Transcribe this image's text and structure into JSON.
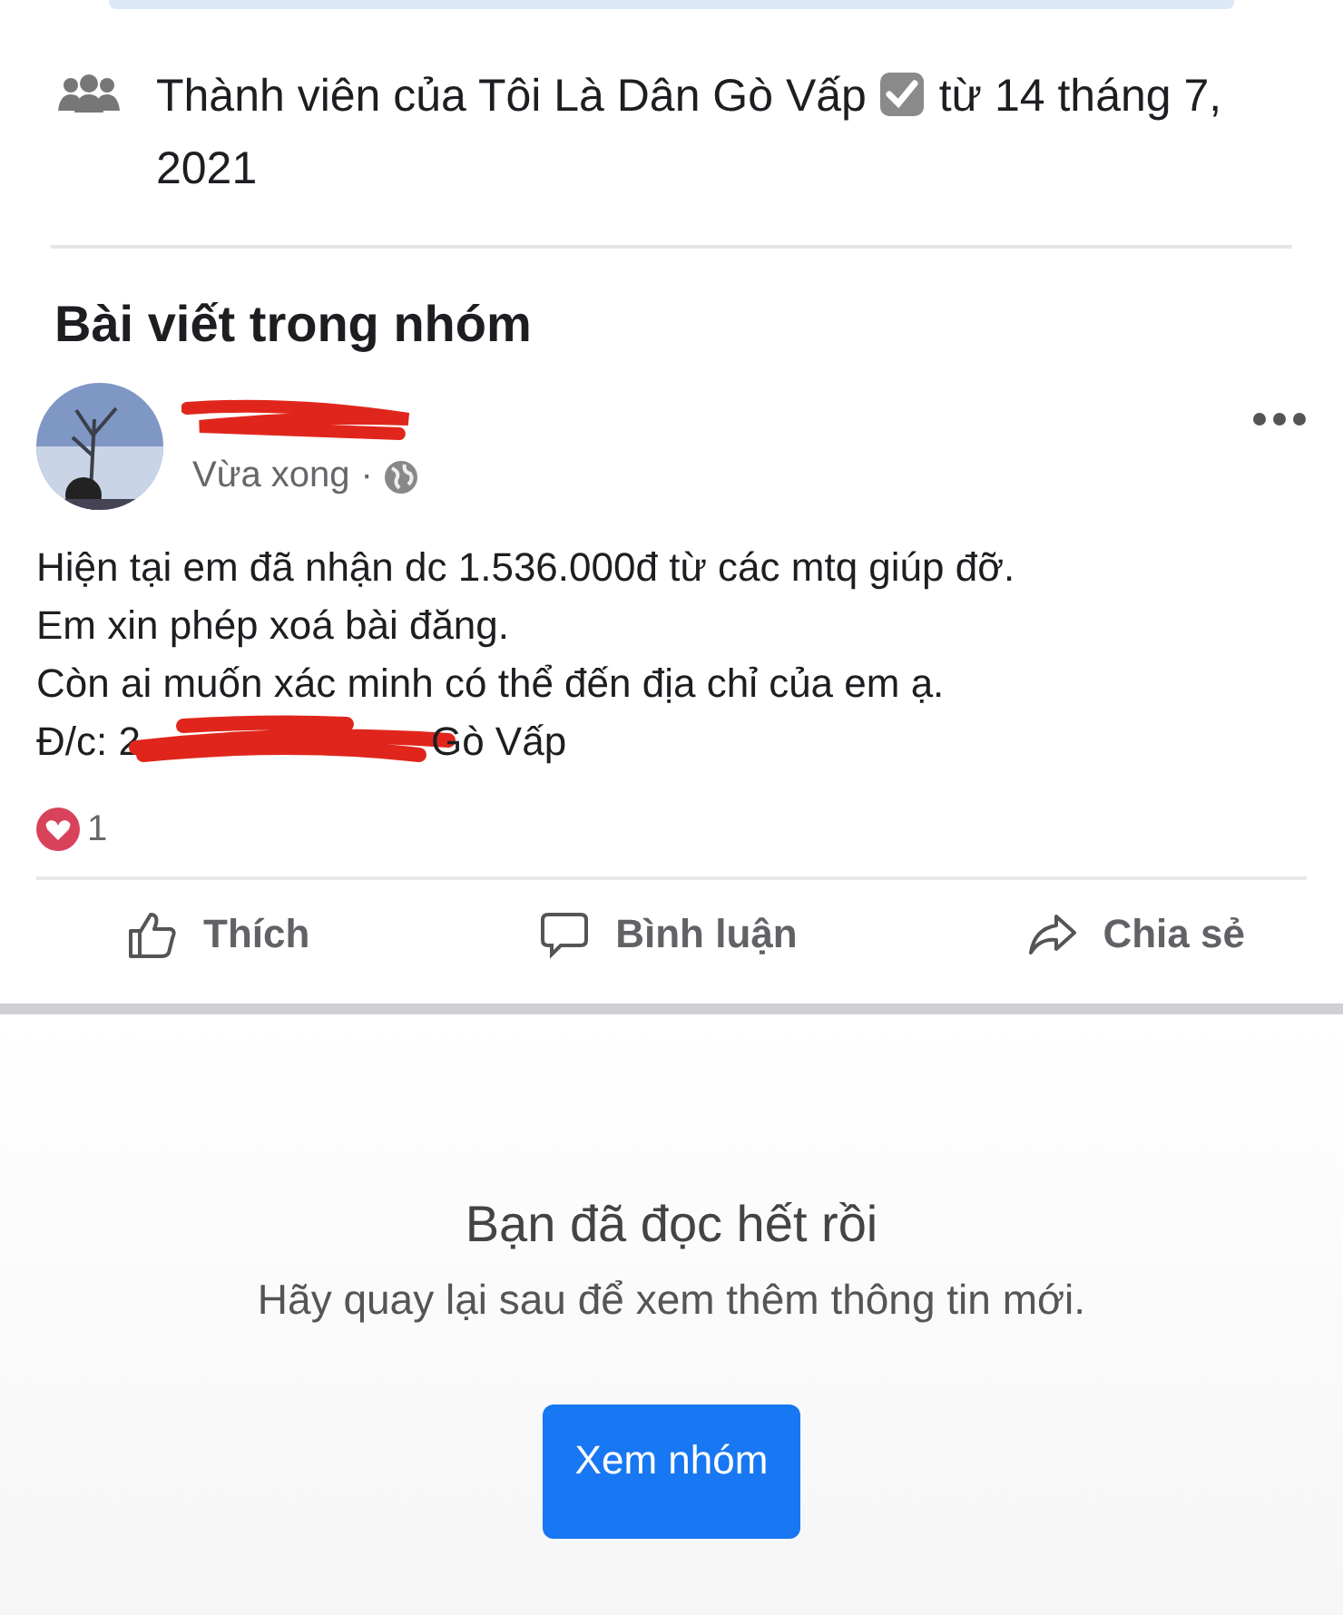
{
  "membership": {
    "text": "Thành viên của Tôi Là Dân Gò Vấp",
    "verified": true,
    "date": "từ 14 tháng 7, 2021"
  },
  "section_title": "Bài viết trong nhóm",
  "post": {
    "time": "Vừa xong",
    "time_separator": "·",
    "lines": [
      "Hiện tại em đã nhận dc 1.536.000đ từ các mtq giúp đỡ.",
      "Em xin phép xoá bài đăng.",
      "Còn ai muốn xác minh có thể đến địa chỉ của em ạ."
    ],
    "address_start": "Đ/c: 2",
    "address_end": "Gò Vấp",
    "reaction_count": "1",
    "actions": [
      {
        "kind": "like",
        "label": "Thích"
      },
      {
        "kind": "comment",
        "label": "Bình luận"
      },
      {
        "kind": "share",
        "label": "Chia sẻ"
      }
    ]
  },
  "end": {
    "title": "Bạn đã đọc hết rồi",
    "subtitle": "Hãy quay lại sau để xem thêm thông tin mới.",
    "button": "Xem nhóm"
  }
}
